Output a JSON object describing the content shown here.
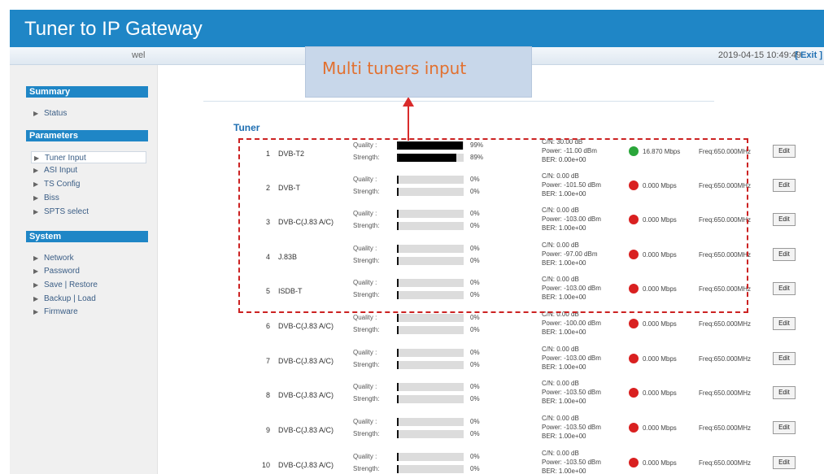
{
  "header": {
    "title": "Tuner to IP Gateway"
  },
  "subbar": {
    "user": "wel",
    "datetime": "2019-04-15 10:49:49",
    "exit_label": "[ Exit ]"
  },
  "sidebar": {
    "summary_title": "Summary",
    "summary_items": [
      "Status"
    ],
    "parameters_title": "Parameters",
    "parameters_items": [
      "Tuner Input",
      "ASI Input",
      "TS Config",
      "Biss",
      "SPTS select"
    ],
    "system_title": "System",
    "system_items": [
      "Network",
      "Password",
      "Save | Restore",
      "Backup | Load",
      "Firmware"
    ]
  },
  "callout": {
    "text": "Multi tuners input"
  },
  "section": {
    "title": "Tuner"
  },
  "colors": {
    "brand": "#1f86c6",
    "status_ok": "#2aa63a",
    "status_err": "#d92020",
    "annotation": "#cc2222"
  },
  "tuners": [
    {
      "num": "1",
      "type": "DVB-T2",
      "quality_label": "Quality :",
      "strength_label": "Strength:",
      "quality_pct": "99%",
      "strength_pct": "89%",
      "quality_fraction": 0.99,
      "strength_fraction": 0.89,
      "cn": "C/N: 30.00 dB",
      "power": "Power: -11.00 dBm",
      "ber": "BER: 0.00e+00",
      "status": "ok",
      "rate": "16.870 Mbps",
      "freq": "Freq:650.000MHz",
      "edit_label": "Edit"
    },
    {
      "num": "2",
      "type": "DVB-T",
      "quality_label": "Quality :",
      "strength_label": "Strength:",
      "quality_pct": "0%",
      "strength_pct": "0%",
      "quality_fraction": 0,
      "strength_fraction": 0,
      "cn": "C/N: 0.00 dB",
      "power": "Power: -101.50 dBm",
      "ber": "BER: 1.00e+00",
      "status": "err",
      "rate": "0.000 Mbps",
      "freq": "Freq:650.000MHz",
      "edit_label": "Edit"
    },
    {
      "num": "3",
      "type": "DVB-C(J.83 A/C)",
      "quality_label": "Quality :",
      "strength_label": "Strength:",
      "quality_pct": "0%",
      "strength_pct": "0%",
      "quality_fraction": 0,
      "strength_fraction": 0,
      "cn": "C/N: 0.00 dB",
      "power": "Power: -103.00 dBm",
      "ber": "BER: 1.00e+00",
      "status": "err",
      "rate": "0.000 Mbps",
      "freq": "Freq:650.000MHz",
      "edit_label": "Edit"
    },
    {
      "num": "4",
      "type": "J.83B",
      "quality_label": "Quality :",
      "strength_label": "Strength:",
      "quality_pct": "0%",
      "strength_pct": "0%",
      "quality_fraction": 0,
      "strength_fraction": 0,
      "cn": "C/N: 0.00 dB",
      "power": "Power: -97.00 dBm",
      "ber": "BER: 1.00e+00",
      "status": "err",
      "rate": "0.000 Mbps",
      "freq": "Freq:650.000MHz",
      "edit_label": "Edit"
    },
    {
      "num": "5",
      "type": "ISDB-T",
      "quality_label": "Quality :",
      "strength_label": "Strength:",
      "quality_pct": "0%",
      "strength_pct": "0%",
      "quality_fraction": 0,
      "strength_fraction": 0,
      "cn": "C/N: 0.00 dB",
      "power": "Power: -103.00 dBm",
      "ber": "BER: 1.00e+00",
      "status": "err",
      "rate": "0.000 Mbps",
      "freq": "Freq:650.000MHz",
      "edit_label": "Edit"
    },
    {
      "num": "6",
      "type": "DVB-C(J.83 A/C)",
      "quality_label": "Quality :",
      "strength_label": "Strength:",
      "quality_pct": "0%",
      "strength_pct": "0%",
      "quality_fraction": 0,
      "strength_fraction": 0,
      "cn": "C/N: 0.00 dB",
      "power": "Power: -100.00 dBm",
      "ber": "BER: 1.00e+00",
      "status": "err",
      "rate": "0.000 Mbps",
      "freq": "Freq:650.000MHz",
      "edit_label": "Edit"
    },
    {
      "num": "7",
      "type": "DVB-C(J.83 A/C)",
      "quality_label": "Quality :",
      "strength_label": "Strength:",
      "quality_pct": "0%",
      "strength_pct": "0%",
      "quality_fraction": 0,
      "strength_fraction": 0,
      "cn": "C/N: 0.00 dB",
      "power": "Power: -103.00 dBm",
      "ber": "BER: 1.00e+00",
      "status": "err",
      "rate": "0.000 Mbps",
      "freq": "Freq:650.000MHz",
      "edit_label": "Edit"
    },
    {
      "num": "8",
      "type": "DVB-C(J.83 A/C)",
      "quality_label": "Quality :",
      "strength_label": "Strength:",
      "quality_pct": "0%",
      "strength_pct": "0%",
      "quality_fraction": 0,
      "strength_fraction": 0,
      "cn": "C/N: 0.00 dB",
      "power": "Power: -103.50 dBm",
      "ber": "BER: 1.00e+00",
      "status": "err",
      "rate": "0.000 Mbps",
      "freq": "Freq:650.000MHz",
      "edit_label": "Edit"
    },
    {
      "num": "9",
      "type": "DVB-C(J.83 A/C)",
      "quality_label": "Quality :",
      "strength_label": "Strength:",
      "quality_pct": "0%",
      "strength_pct": "0%",
      "quality_fraction": 0,
      "strength_fraction": 0,
      "cn": "C/N: 0.00 dB",
      "power": "Power: -103.50 dBm",
      "ber": "BER: 1.00e+00",
      "status": "err",
      "rate": "0.000 Mbps",
      "freq": "Freq:650.000MHz",
      "edit_label": "Edit"
    },
    {
      "num": "10",
      "type": "DVB-C(J.83 A/C)",
      "quality_label": "Quality :",
      "strength_label": "Strength:",
      "quality_pct": "0%",
      "strength_pct": "0%",
      "quality_fraction": 0,
      "strength_fraction": 0,
      "cn": "C/N: 0.00 dB",
      "power": "Power: -103.50 dBm",
      "ber": "BER: 1.00e+00",
      "status": "err",
      "rate": "0.000 Mbps",
      "freq": "Freq:650.000MHz",
      "edit_label": "Edit"
    }
  ]
}
